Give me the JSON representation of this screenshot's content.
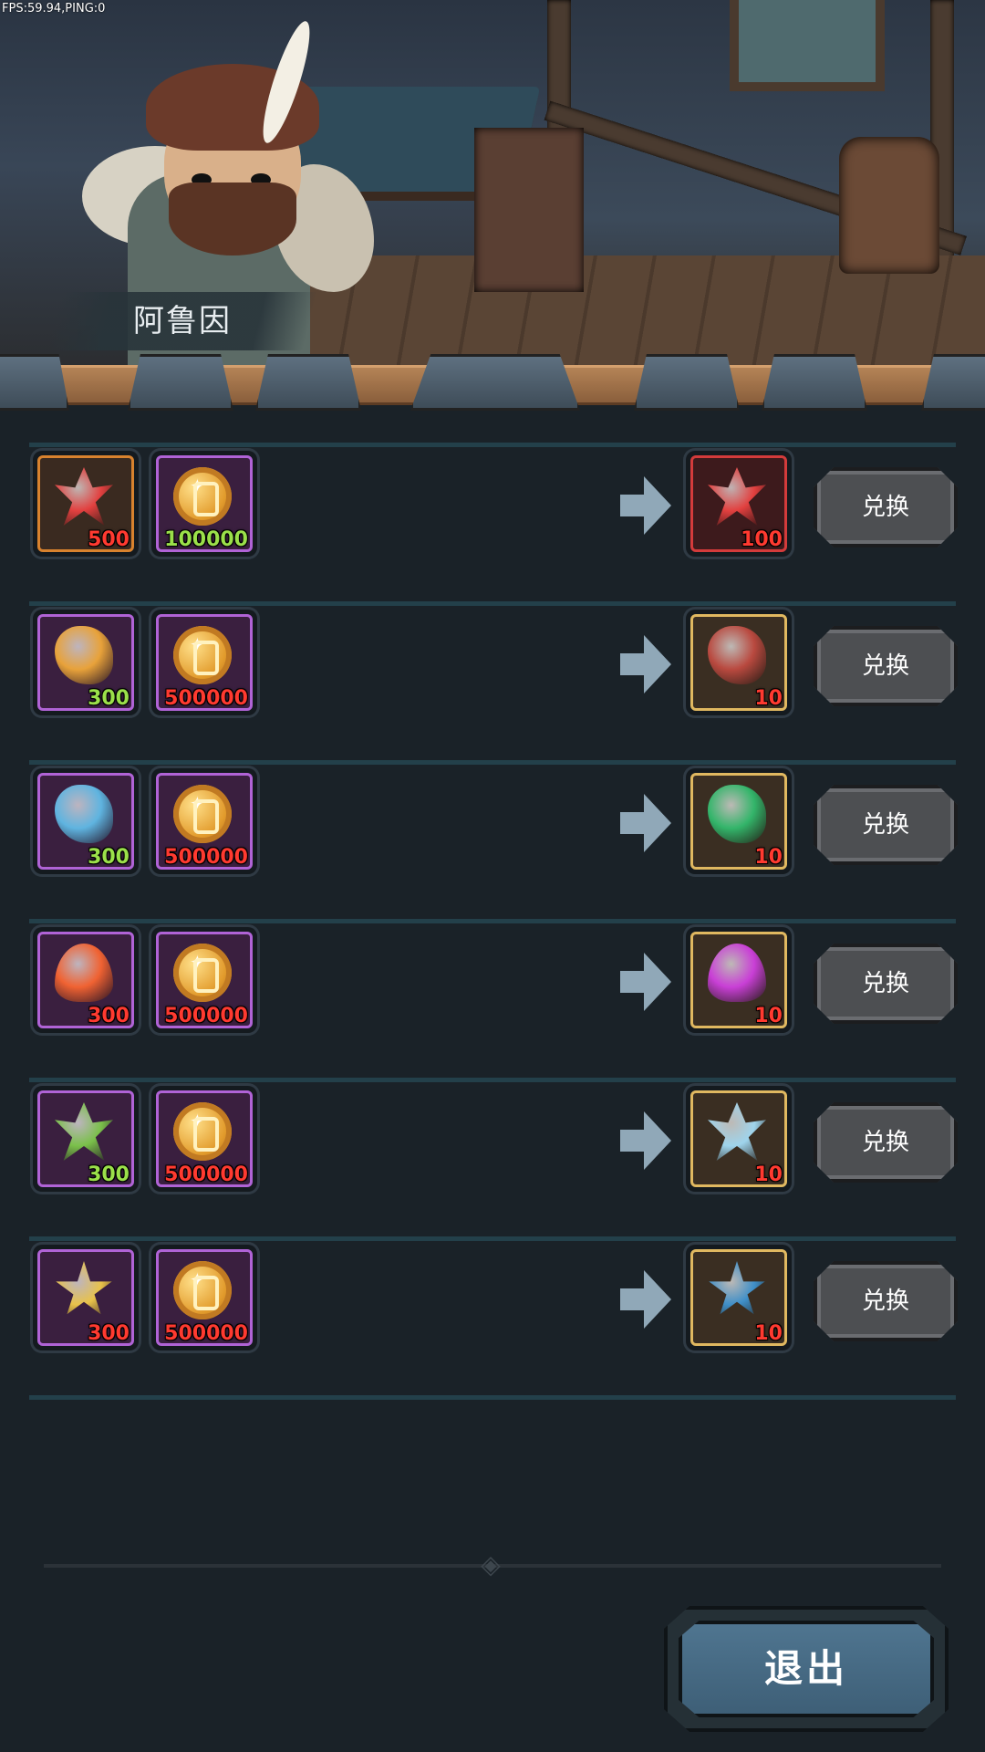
{
  "hud": {
    "fps_ping": "FPS:59.94,PING:0"
  },
  "npc": {
    "name": "阿鲁因"
  },
  "exchange_button_label": "兑换",
  "exit_label": "退出",
  "rows": [
    {
      "inputs": [
        {
          "item": "fire-gem",
          "qty": "500",
          "qty_color": "green",
          "rarity": "gold"
        }
      ],
      "output": {
        "item": "red-crystal",
        "qty": "100",
        "qty_color": "green",
        "rarity": "orange"
      },
      "partial": true
    },
    {
      "inputs": [
        {
          "item": "red-crystal",
          "qty": "500",
          "qty_color": "red",
          "rarity": "orange"
        },
        {
          "item": "gold-coin",
          "qty": "100000",
          "qty_color": "green",
          "rarity": "purple"
        }
      ],
      "output": {
        "item": "red-crystal",
        "qty": "100",
        "qty_color": "red",
        "rarity": "red"
      }
    },
    {
      "inputs": [
        {
          "item": "amber-ore",
          "qty": "300",
          "qty_color": "green",
          "rarity": "purple"
        },
        {
          "item": "gold-coin",
          "qty": "500000",
          "qty_color": "red",
          "rarity": "purple"
        }
      ],
      "output": {
        "item": "ruby-ore",
        "qty": "10",
        "qty_color": "red",
        "rarity": "gold"
      }
    },
    {
      "inputs": [
        {
          "item": "blue-stone",
          "qty": "300",
          "qty_color": "green",
          "rarity": "purple"
        },
        {
          "item": "gold-coin",
          "qty": "500000",
          "qty_color": "red",
          "rarity": "purple"
        }
      ],
      "output": {
        "item": "green-stone",
        "qty": "10",
        "qty_color": "red",
        "rarity": "gold"
      }
    },
    {
      "inputs": [
        {
          "item": "flame-stone",
          "qty": "300",
          "qty_color": "red",
          "rarity": "purple"
        },
        {
          "item": "gold-coin",
          "qty": "500000",
          "qty_color": "red",
          "rarity": "purple"
        }
      ],
      "output": {
        "item": "purple-flame-stone",
        "qty": "10",
        "qty_color": "red",
        "rarity": "gold"
      }
    },
    {
      "inputs": [
        {
          "item": "green-crystal",
          "qty": "300",
          "qty_color": "green",
          "rarity": "purple"
        },
        {
          "item": "gold-coin",
          "qty": "500000",
          "qty_color": "red",
          "rarity": "purple"
        }
      ],
      "output": {
        "item": "ice-crystal",
        "qty": "10",
        "qty_color": "red",
        "rarity": "gold"
      }
    },
    {
      "inputs": [
        {
          "item": "gold-star-stone",
          "qty": "300",
          "qty_color": "red",
          "rarity": "purple"
        },
        {
          "item": "gold-coin",
          "qty": "500000",
          "qty_color": "red",
          "rarity": "purple"
        }
      ],
      "output": {
        "item": "blue-star-stone",
        "qty": "10",
        "qty_color": "red",
        "rarity": "gold"
      }
    }
  ],
  "item_colors": {
    "fire-gem": "#f0703a",
    "red-crystal": "#e2403f",
    "amber-ore": "#e8a23a",
    "ruby-ore": "#b9493f",
    "blue-stone": "#5fb4e0",
    "green-stone": "#33b56a",
    "flame-stone": "#f06232",
    "purple-flame-stone": "#c93fd6",
    "green-crystal": "#7ac04a",
    "ice-crystal": "#9fd4ec",
    "gold-star-stone": "#e8c24a",
    "blue-star-stone": "#3f8fc8"
  }
}
